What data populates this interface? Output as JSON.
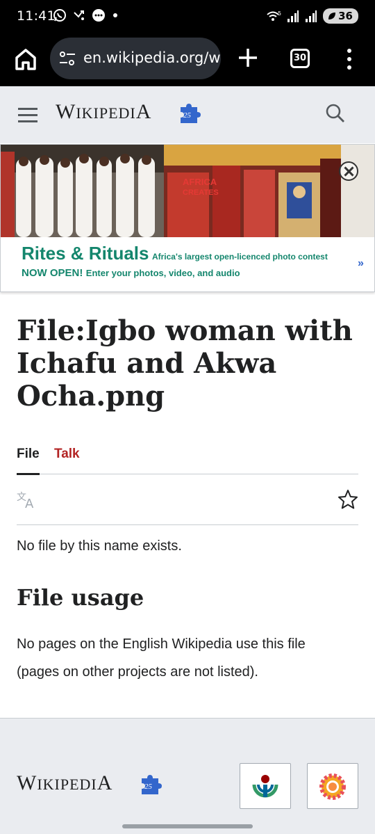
{
  "status": {
    "time": "11:41",
    "battery": "36",
    "left_icons": [
      "whatsapp-icon",
      "missed-call-icon",
      "message-icon",
      "dot-icon"
    ],
    "right_icons": [
      "wifi-icon",
      "signal-icon",
      "signal-icon"
    ]
  },
  "browser": {
    "url": "en.wikipedia.org/wi",
    "tab_count": "30"
  },
  "header": {
    "logo_text_lead": "W",
    "logo_text_rest": "IKIPEDI",
    "logo_text_tail": "A"
  },
  "banner": {
    "title": "Rites & Rituals",
    "description": "Africa's largest open-licenced photo contest",
    "now_open": "NOW OPEN!",
    "entry_text": "Enter your photos, video, and audio",
    "arrow": "»"
  },
  "page": {
    "title": "File:Igbo woman with Ichafu and Akwa Ocha.png",
    "tabs": [
      {
        "label": "File",
        "active": true
      },
      {
        "label": "Talk",
        "active": false
      }
    ],
    "no_file_message": "No file by this name exists.",
    "file_usage_heading": "File usage",
    "file_usage_text": "No pages on the English Wikipedia use this file (pages on other projects are not listed)."
  },
  "footer": {
    "logo_text_lead": "W",
    "logo_text_rest": "IKIPEDI",
    "logo_text_tail": "A"
  },
  "colors": {
    "banner_green": "#14866d",
    "talk_red": "#b32424",
    "header_bg": "#eaecf0"
  }
}
